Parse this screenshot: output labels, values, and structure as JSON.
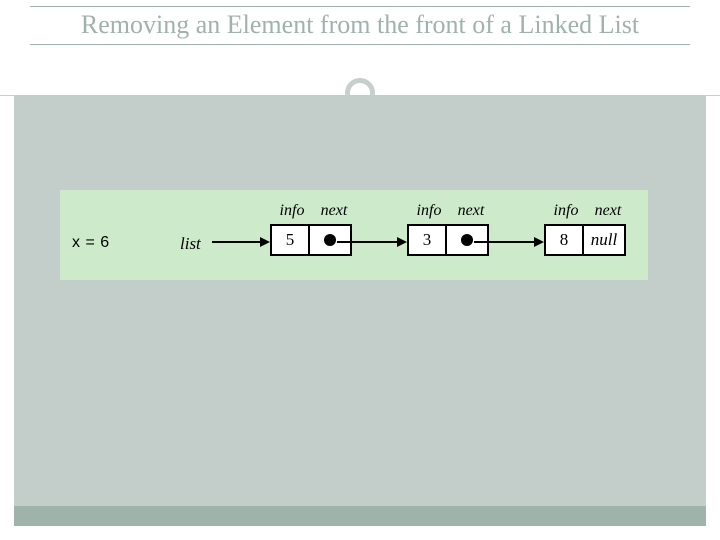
{
  "title": "Removing an Element from the front of a Linked List",
  "diagram": {
    "x_label": "x = 6",
    "list_label": "list",
    "field_info": "info",
    "field_next": "next",
    "nodes": [
      {
        "info": "5",
        "next_type": "ptr"
      },
      {
        "info": "3",
        "next_type": "ptr"
      },
      {
        "info": "8",
        "next_type": "null"
      }
    ],
    "null_text": "null"
  }
}
